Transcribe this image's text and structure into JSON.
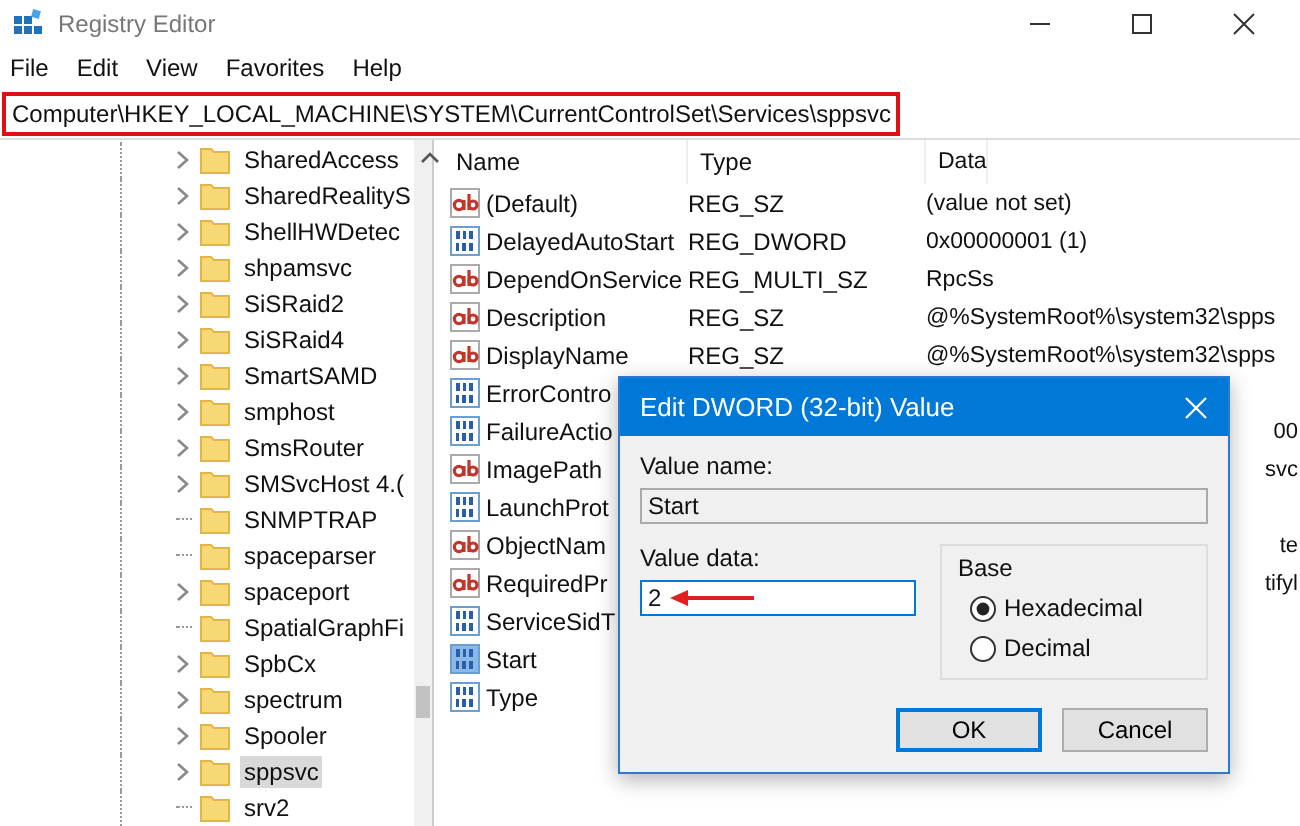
{
  "window": {
    "title": "Registry Editor"
  },
  "menu": [
    "File",
    "Edit",
    "View",
    "Favorites",
    "Help"
  ],
  "address_bar": {
    "value": "Computer\\HKEY_LOCAL_MACHINE\\SYSTEM\\CurrentControlSet\\Services\\sppsvc",
    "highlighted": true
  },
  "tree": [
    {
      "label": "SharedAccess",
      "has_children": true,
      "selected": false
    },
    {
      "label": "SharedRealityS",
      "has_children": true,
      "selected": false
    },
    {
      "label": "ShellHWDetec",
      "has_children": true,
      "selected": false
    },
    {
      "label": "shpamsvc",
      "has_children": true,
      "selected": false
    },
    {
      "label": "SiSRaid2",
      "has_children": true,
      "selected": false
    },
    {
      "label": "SiSRaid4",
      "has_children": true,
      "selected": false
    },
    {
      "label": "SmartSAMD",
      "has_children": true,
      "selected": false
    },
    {
      "label": "smphost",
      "has_children": true,
      "selected": false
    },
    {
      "label": "SmsRouter",
      "has_children": true,
      "selected": false
    },
    {
      "label": "SMSvcHost 4.(",
      "has_children": true,
      "selected": false
    },
    {
      "label": "SNMPTRAP",
      "has_children": false,
      "selected": false
    },
    {
      "label": "spaceparser",
      "has_children": false,
      "selected": false
    },
    {
      "label": "spaceport",
      "has_children": true,
      "selected": false
    },
    {
      "label": "SpatialGraphFi",
      "has_children": false,
      "selected": false
    },
    {
      "label": "SpbCx",
      "has_children": true,
      "selected": false
    },
    {
      "label": "spectrum",
      "has_children": true,
      "selected": false
    },
    {
      "label": "Spooler",
      "has_children": true,
      "selected": false
    },
    {
      "label": "sppsvc",
      "has_children": true,
      "selected": true
    },
    {
      "label": "srv2",
      "has_children": false,
      "selected": false
    }
  ],
  "values_table": {
    "columns": [
      "Name",
      "Type",
      "Data"
    ],
    "rows": [
      {
        "kind": "string",
        "name": "(Default)",
        "type": "REG_SZ",
        "data": "(value not set)",
        "selected": false
      },
      {
        "kind": "binary",
        "name": "DelayedAutoStart",
        "type": "REG_DWORD",
        "data": "0x00000001 (1)",
        "selected": false
      },
      {
        "kind": "string",
        "name": "DependOnService",
        "type": "REG_MULTI_SZ",
        "data": "RpcSs",
        "selected": false
      },
      {
        "kind": "string",
        "name": "Description",
        "type": "REG_SZ",
        "data": "@%SystemRoot%\\system32\\spps",
        "selected": false
      },
      {
        "kind": "string",
        "name": "DisplayName",
        "type": "REG_SZ",
        "data": "@%SystemRoot%\\system32\\spps",
        "selected": false
      },
      {
        "kind": "binary",
        "name": "ErrorContro",
        "selected": false
      },
      {
        "kind": "binary",
        "name": "FailureActio",
        "data": "00",
        "selected": false
      },
      {
        "kind": "string",
        "name": "ImagePath",
        "data": "svc",
        "selected": false
      },
      {
        "kind": "binary",
        "name": "LaunchProt",
        "selected": false
      },
      {
        "kind": "string",
        "name": "ObjectNam",
        "data": "te",
        "selected": false
      },
      {
        "kind": "string",
        "name": "RequiredPr",
        "data": "tifyl",
        "selected": false
      },
      {
        "kind": "binary",
        "name": "ServiceSidT",
        "selected": false
      },
      {
        "kind": "binary",
        "name": "Start",
        "selected": true
      },
      {
        "kind": "binary",
        "name": "Type",
        "selected": false
      }
    ]
  },
  "dialog": {
    "title": "Edit DWORD (32-bit) Value",
    "value_name_label": "Value name:",
    "value_name": "Start",
    "value_data_label": "Value data:",
    "value_data": "2",
    "base_label": "Base",
    "base_options": [
      {
        "label": "Hexadecimal",
        "selected": true
      },
      {
        "label": "Decimal",
        "selected": false
      }
    ],
    "buttons": [
      "OK",
      "Cancel"
    ]
  }
}
